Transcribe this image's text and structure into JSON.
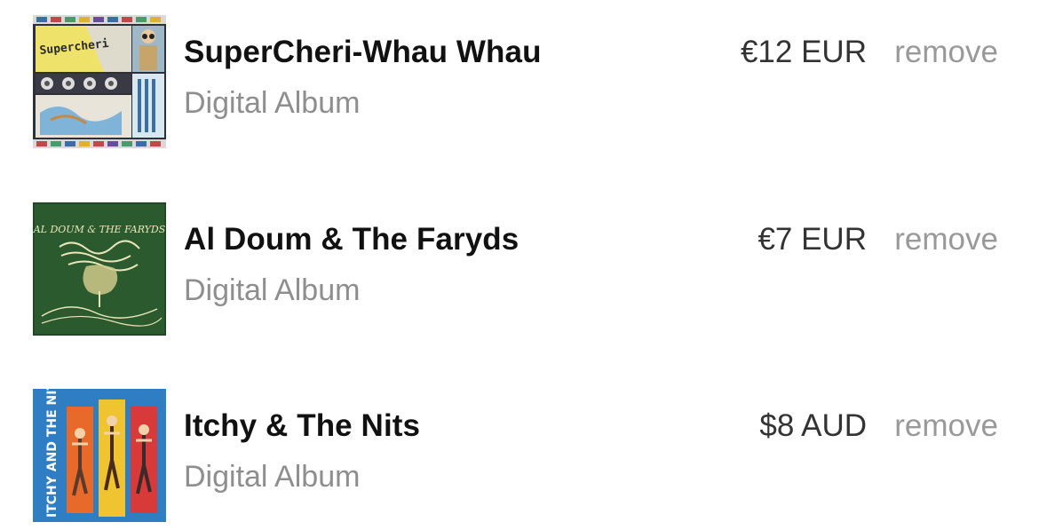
{
  "cart": {
    "items": [
      {
        "title": "SuperCheri-Whau Whau",
        "format": "Digital Album",
        "price": "€12 EUR",
        "remove_label": "remove",
        "art_text": "Supercheri"
      },
      {
        "title": "Al Doum & The Faryds",
        "format": "Digital Album",
        "price": "€7 EUR",
        "remove_label": "remove",
        "art_text": "AL DOUM & THE FARYDS"
      },
      {
        "title": "Itchy & The Nits",
        "format": "Digital Album",
        "price": "$8 AUD",
        "remove_label": "remove",
        "art_text": "ITCHY AND THE NITS"
      }
    ]
  },
  "colors": {
    "title": "#111111",
    "format": "#8e8e8e",
    "price": "#333333",
    "remove": "#999999"
  }
}
